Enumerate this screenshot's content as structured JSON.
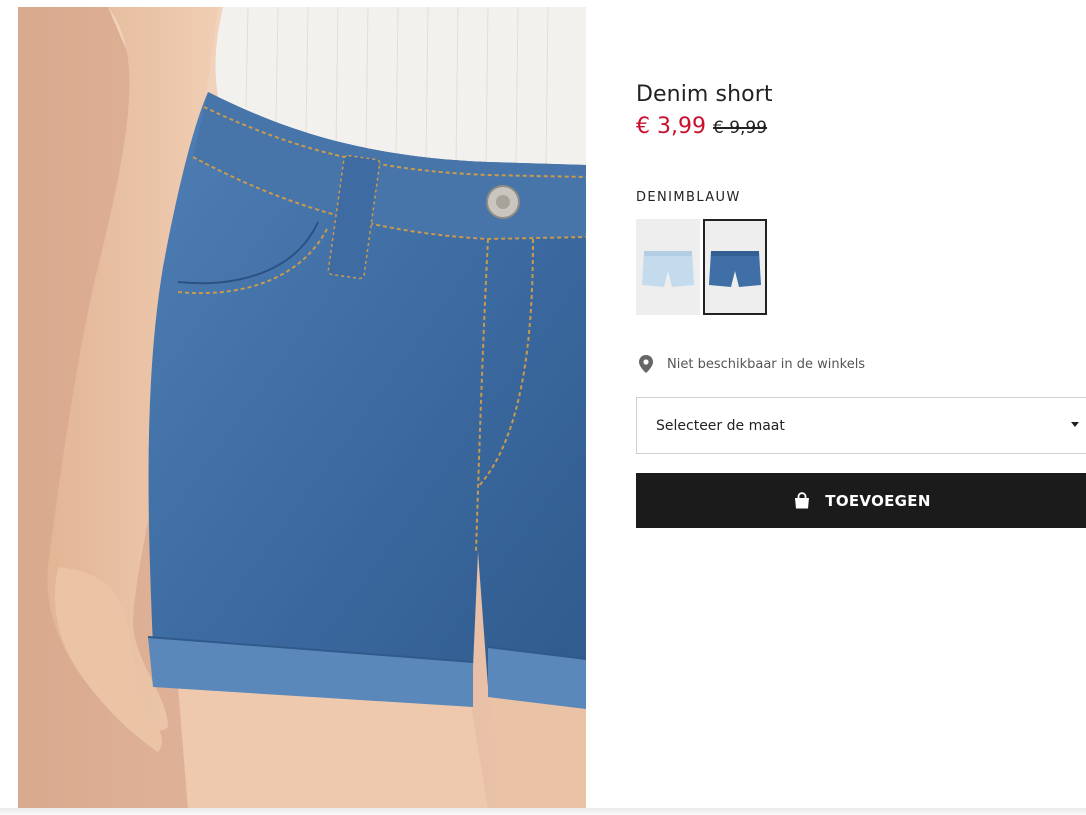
{
  "product": {
    "name": "Denim short",
    "sale_price": "€ 3,99",
    "old_price": "€ 9,99"
  },
  "color": {
    "name": "DENIMBLAUW",
    "swatches": [
      {
        "icon": "light-wash-shorts-thumbnail",
        "color": "#c4dbee",
        "selected": false
      },
      {
        "icon": "denim-blue-shorts-thumbnail",
        "color": "#3f6fa6",
        "selected": true
      }
    ]
  },
  "store": {
    "icon": "location-pin-icon",
    "availability": "Niet beschikbaar in de winkels"
  },
  "size_select": {
    "placeholder": "Selecteer de maat",
    "icon": "caret-down-icon"
  },
  "add_to_cart": {
    "label": "TOEVOEGEN",
    "icon": "shopping-bag-icon"
  },
  "colors": {
    "sale": "#c8102e",
    "button": "#1b1b1b",
    "denim": "#3f6fa6",
    "background": "#e3b8a0"
  }
}
